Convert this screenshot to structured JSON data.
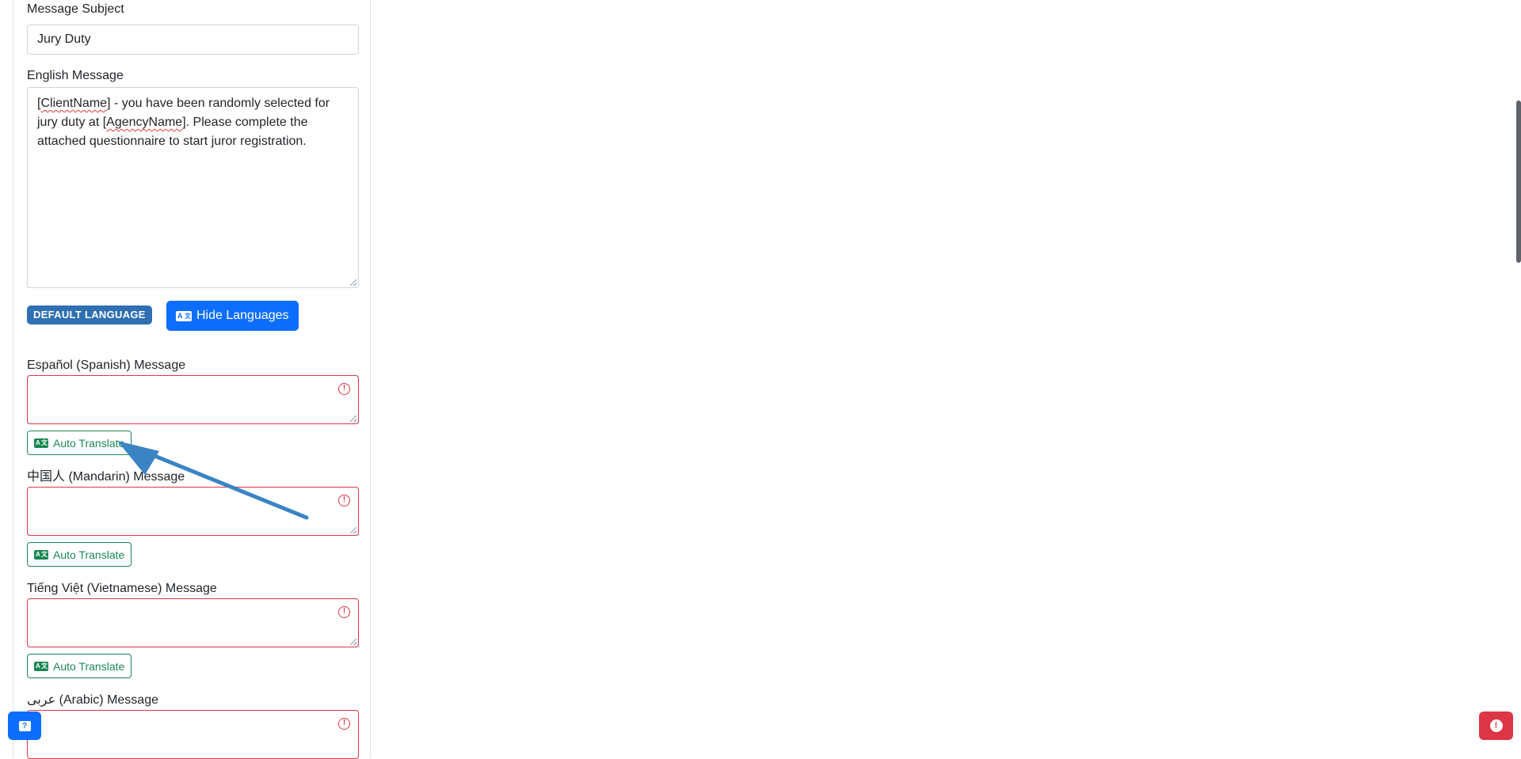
{
  "form": {
    "subject_label": "Message Subject",
    "subject_value": "Jury Duty",
    "english_label": "English Message",
    "english_message": {
      "t1": "[",
      "w1": "ClientName",
      "t2": "] - you have been randomly selected for jury duty at [",
      "w2": "AgencyName",
      "t3": "]. Please complete the attached questionnaire to start juror registration."
    },
    "default_language_badge": "DEFAULT LANGUAGE",
    "hide_languages_button": "Hide Languages",
    "auto_translate_label": "Auto Translate",
    "languages": [
      {
        "label": "Español (Spanish) Message",
        "value": ""
      },
      {
        "label": "中国人 (Mandarin) Message",
        "value": ""
      },
      {
        "label": "Tiếng Việt (Vietnamese) Message",
        "value": ""
      },
      {
        "label": "عربى (Arabic) Message",
        "value": ""
      }
    ]
  },
  "icons": {
    "translate": "translate-icon",
    "error": "error-circle-icon",
    "chat": "chat-icon",
    "alert": "alert-icon"
  },
  "colors": {
    "primary": "#0d6efd",
    "badge": "#2f6fb2",
    "danger": "#dc3545",
    "success": "#198754",
    "annotation_arrow": "#3a84c4"
  }
}
